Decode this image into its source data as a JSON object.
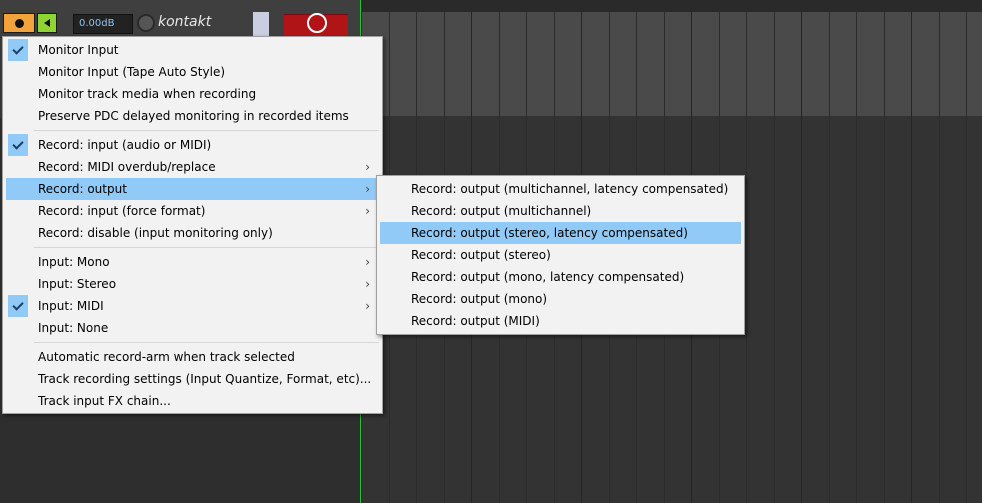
{
  "track": {
    "volume": "0.00dB",
    "name": "kontakt"
  },
  "main_menu": {
    "groups": [
      [
        {
          "label": "Monitor Input",
          "checked": true,
          "submenu": false
        },
        {
          "label": "Monitor Input (Tape Auto Style)",
          "checked": false,
          "submenu": false
        },
        {
          "label": "Monitor track media when recording",
          "checked": false,
          "submenu": false
        },
        {
          "label": "Preserve PDC delayed monitoring in recorded items",
          "checked": false,
          "submenu": false
        }
      ],
      [
        {
          "label": "Record: input (audio or MIDI)",
          "checked": true,
          "submenu": false
        },
        {
          "label": "Record: MIDI overdub/replace",
          "checked": false,
          "submenu": true
        },
        {
          "label": "Record: output",
          "checked": false,
          "submenu": true,
          "highlighted": true
        },
        {
          "label": "Record: input (force format)",
          "checked": false,
          "submenu": true
        },
        {
          "label": "Record: disable (input monitoring only)",
          "checked": false,
          "submenu": false
        }
      ],
      [
        {
          "label": "Input: Mono",
          "checked": false,
          "submenu": true
        },
        {
          "label": "Input: Stereo",
          "checked": false,
          "submenu": true
        },
        {
          "label": "Input: MIDI",
          "checked": true,
          "submenu": true
        },
        {
          "label": "Input: None",
          "checked": false,
          "submenu": false
        }
      ],
      [
        {
          "label": "Automatic record-arm when track selected",
          "checked": false,
          "submenu": false
        },
        {
          "label": "Track recording settings (Input Quantize, Format, etc)...",
          "checked": false,
          "submenu": false
        },
        {
          "label": "Track input FX chain...",
          "checked": false,
          "submenu": false
        }
      ]
    ]
  },
  "sub_menu": {
    "items": [
      {
        "label": "Record: output (multichannel, latency compensated)",
        "highlighted": false
      },
      {
        "label": "Record: output (multichannel)",
        "highlighted": false
      },
      {
        "label": "Record: output (stereo, latency compensated)",
        "highlighted": true
      },
      {
        "label": "Record: output (stereo)",
        "highlighted": false
      },
      {
        "label": "Record: output (mono, latency compensated)",
        "highlighted": false
      },
      {
        "label": "Record: output (mono)",
        "highlighted": false
      },
      {
        "label": "Record: output (MIDI)",
        "highlighted": false
      }
    ]
  },
  "colors": {
    "highlight": "#91c9f7",
    "record_arm": "#f2a43a",
    "monitor": "#8fd435",
    "edit_cursor": "#27c23a"
  }
}
